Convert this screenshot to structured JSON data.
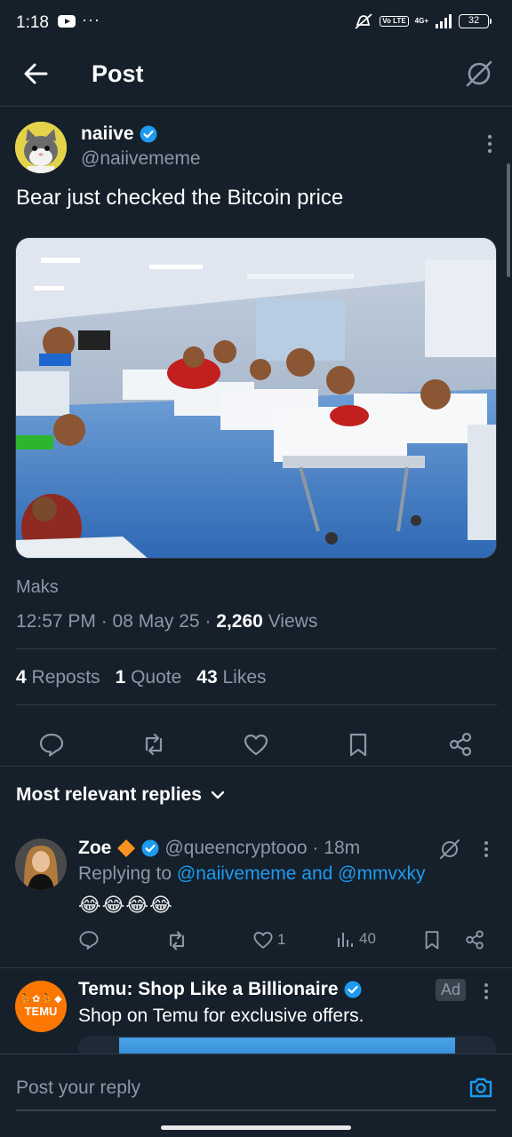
{
  "status_bar": {
    "time": "1:18",
    "overflow": "···",
    "volte": "Vo LTE",
    "network": "4G+",
    "battery": "32"
  },
  "header": {
    "title": "Post"
  },
  "post": {
    "author_name": "naiive",
    "author_handle": "@naiivememe",
    "text": "Bear just checked the Bitcoin price",
    "caption": "Maks",
    "time": "12:57 PM · 08 May 25 · ",
    "views_count": "2,260",
    "views_label": " Views",
    "reposts_count": "4",
    "reposts_label": " Reposts",
    "quotes_count": "1",
    "quotes_label": " Quote",
    "likes_count": "43",
    "likes_label": " Likes"
  },
  "replies_filter": "Most relevant replies",
  "reply": {
    "name": "Zoe",
    "handle": "@queencryptooo · 18m",
    "replying_prefix": "Replying to ",
    "replying_to": "@naiivememe and @mmvxky",
    "emojis": "😂😂😂😂",
    "likes": "1",
    "views": "40"
  },
  "ad": {
    "logo_text": "TEMU",
    "name": "Temu: Shop Like a Billionaire",
    "badge": "Ad",
    "description": "Shop on Temu for exclusive offers."
  },
  "compose": {
    "placeholder": "Post your reply"
  },
  "colors": {
    "background": "#15202b",
    "accent": "#1d9bf0",
    "muted": "#8b98a5",
    "temu": "#fb7701"
  }
}
